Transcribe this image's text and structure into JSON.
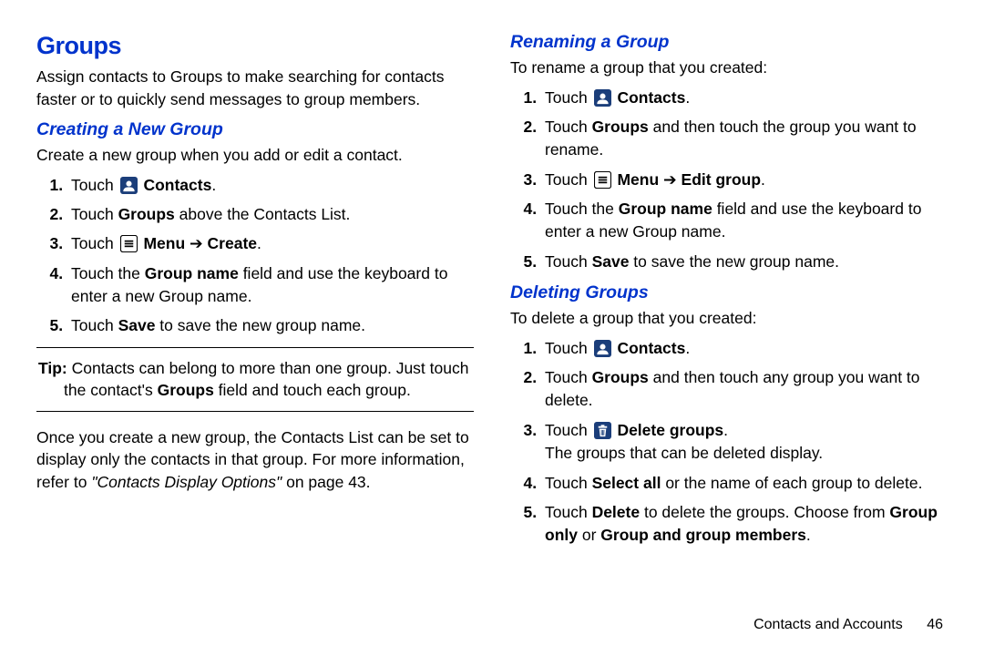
{
  "h1": "Groups",
  "intro": "Assign contacts to Groups to make searching for contacts faster or to quickly send messages to group members.",
  "sec1": {
    "title": "Creating a New Group",
    "lead": "Create a new group when you add or edit a contact.",
    "s1a": "Touch ",
    "s1b": "Contacts",
    "s1c": ".",
    "s2a": "Touch ",
    "s2b": "Groups",
    "s2c": " above the Contacts List.",
    "s3a": "Touch ",
    "s3b": "Menu",
    "s3arrow": " ➔ ",
    "s3c": "Create",
    "s3d": ".",
    "s4a": "Touch the ",
    "s4b": "Group name",
    "s4c": " field and use the keyboard to enter a new Group name.",
    "s5a": "Touch ",
    "s5b": "Save",
    "s5c": " to save the new group name."
  },
  "tip": {
    "label": "Tip:",
    "body": " Contacts can belong to more than one group. Just touch the contact's ",
    "b1": "Groups",
    "tail": " field and touch each group."
  },
  "post": {
    "a": "Once you create a new group, the Contacts List can be set to display only the contacts in that group. For more information, refer to ",
    "xref": "\"Contacts Display Options\"",
    "b": " on page 43."
  },
  "sec2": {
    "title": "Renaming a Group",
    "lead": "To rename a group that you created:",
    "s1a": "Touch ",
    "s1b": "Contacts",
    "s1c": ".",
    "s2a": "Touch ",
    "s2b": "Groups",
    "s2c": " and then touch the group you want to rename.",
    "s3a": "Touch ",
    "s3b": "Menu",
    "s3arrow": " ➔ ",
    "s3c": "Edit group",
    "s3d": ".",
    "s4a": "Touch the ",
    "s4b": "Group name",
    "s4c": " field and use the keyboard to enter a new Group name.",
    "s5a": "Touch ",
    "s5b": "Save",
    "s5c": " to save the new group name."
  },
  "sec3": {
    "title": "Deleting Groups",
    "lead": "To delete a group that you created:",
    "s1a": "Touch ",
    "s1b": "Contacts",
    "s1c": ".",
    "s2a": "Touch ",
    "s2b": "Groups",
    "s2c": " and then touch any group you want to delete.",
    "s3a": "Touch ",
    "s3b": "Delete groups",
    "s3c": ".",
    "s3line2": "The groups that can be deleted display.",
    "s4a": "Touch ",
    "s4b": "Select all",
    "s4c": " or the name of each group to delete.",
    "s5a": "Touch ",
    "s5b": "Delete",
    "s5c": " to delete the groups. Choose from ",
    "s5d": "Group only",
    "s5e": " or ",
    "s5f": "Group and group members",
    "s5g": "."
  },
  "footer": {
    "section": "Contacts and Accounts",
    "page": "46"
  }
}
